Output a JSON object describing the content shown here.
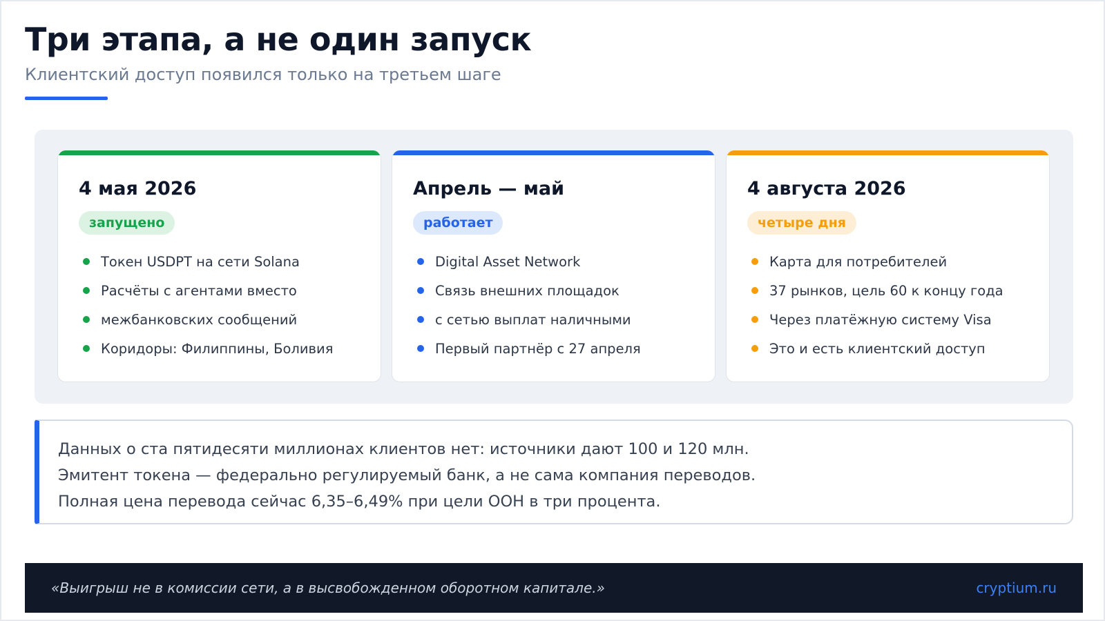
{
  "header": {
    "title": "Три этапа, а не один запуск",
    "subtitle": "Клиентский доступ появился только на третьем шаге"
  },
  "stages": [
    {
      "date": "4 мая 2026",
      "status": "запущено",
      "accent": "#16a34a",
      "status_bg": "#dcf3e4",
      "items": [
        "Токен USDPT на сети Solana",
        "Расчёты с агентами вместо",
        "межбанковских сообщений",
        "Коридоры: Филиппины, Боливия"
      ]
    },
    {
      "date": "Апрель — май",
      "status": "работает",
      "accent": "#2563eb",
      "status_bg": "#dce8fb",
      "items": [
        "Digital Asset Network",
        "Связь внешних площадок",
        "с сетью выплат наличными",
        "Первый партнёр с 27 апреля"
      ]
    },
    {
      "date": "4 августа 2026",
      "status": "четыре дня",
      "accent": "#f59e0b",
      "status_bg": "#fdeed5",
      "items": [
        "Карта для потребителей",
        "37 рынков, цель 60 к концу года",
        "Через платёжную систему Visa",
        "Это и есть клиентский доступ"
      ]
    }
  ],
  "note": {
    "lines": [
      "Данных о ста пятидесяти миллионах клиентов нет: источники дают 100 и 120 млн.",
      "Эмитент токена — федерально регулируемый банк, а не сама компания переводов.",
      "Полная цена перевода сейчас 6,35–6,49% при цели ООН в три процента."
    ]
  },
  "footer": {
    "quote": "«Выигрыш не в комиссии сети, а в высвобожденном оборотном капитале.»",
    "brand": "cryptium.ru"
  },
  "colors": {
    "accent_blue": "#2563eb",
    "footer_bg": "#111827",
    "panel_bg": "#eef1f6"
  }
}
